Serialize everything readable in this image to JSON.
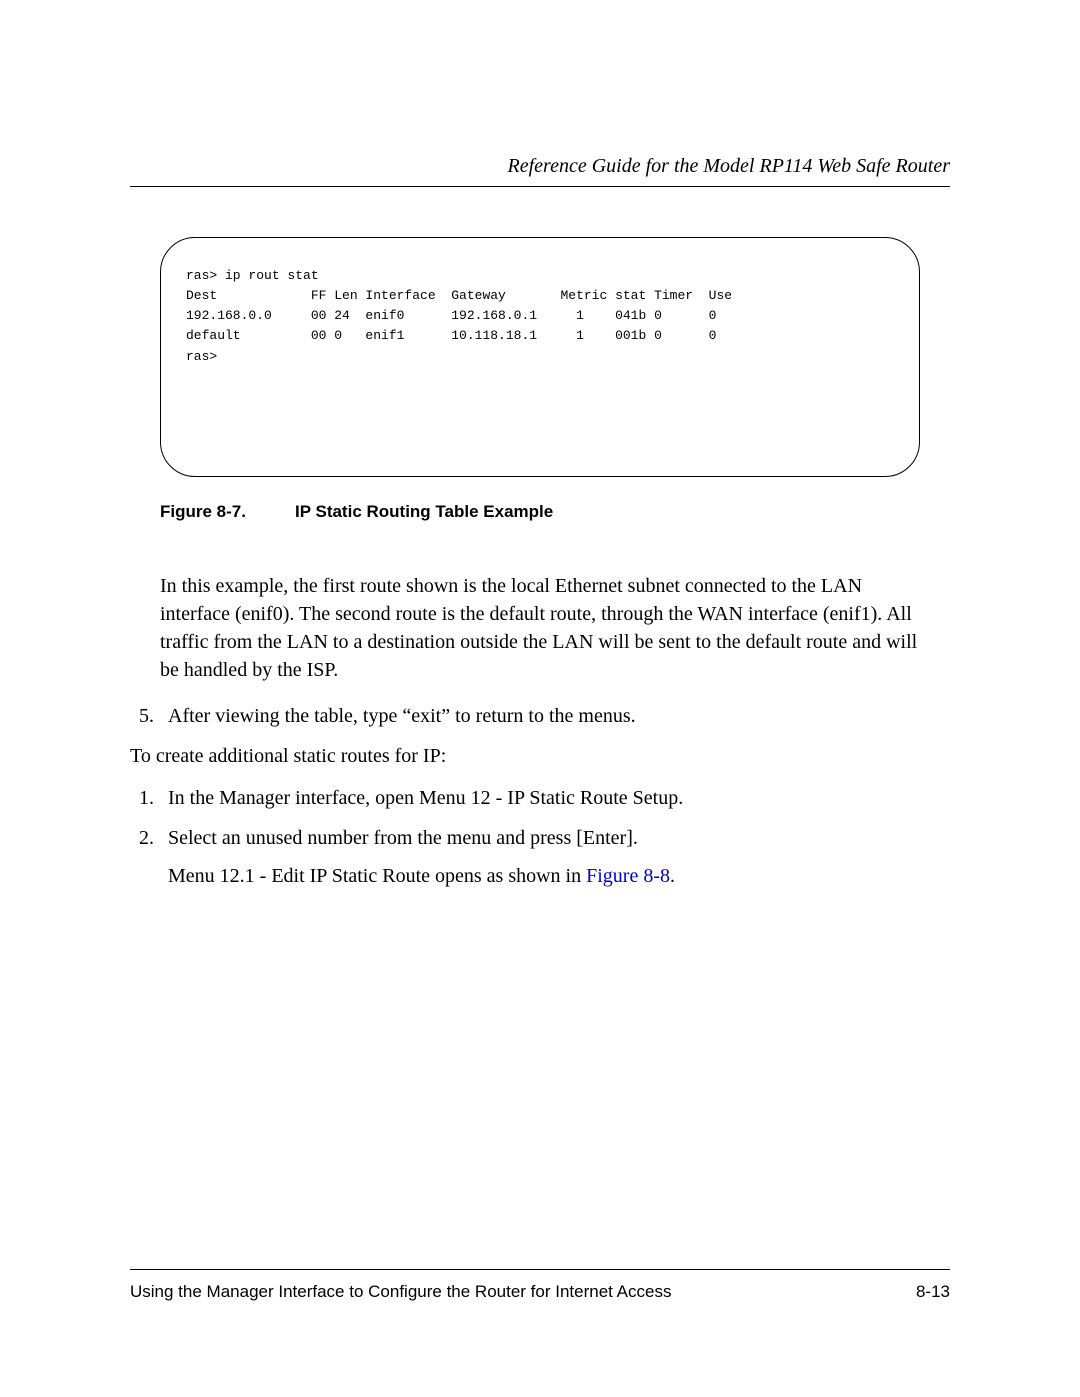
{
  "header": {
    "title": "Reference Guide for the Model RP114 Web Safe Router"
  },
  "terminal": {
    "content": "ras> ip rout stat\nDest            FF Len Interface  Gateway       Metric stat Timer  Use\n192.168.0.0     00 24  enif0      192.168.0.1     1    041b 0      0\ndefault         00 0   enif1      10.118.18.1     1    001b 0      0\nras>"
  },
  "figure": {
    "label": "Figure 8-7.",
    "title": "IP Static Routing Table Example"
  },
  "paragraphs": {
    "example": "In this example, the first route shown is the local Ethernet subnet connected to the LAN interface (enif0). The second route is the default route, through the WAN interface (enif1). All traffic from the LAN to a destination outside the LAN will be sent to the default route and will be handled by the ISP.",
    "intro": "To create additional static routes for IP:"
  },
  "steps_a": {
    "5": {
      "marker": "5.",
      "text": "After viewing the table, type “exit” to return to the menus."
    }
  },
  "steps_b": {
    "1": {
      "marker": "1.",
      "text": "In the Manager interface, open Menu 12 - IP Static Route Setup."
    },
    "2": {
      "marker": "2.",
      "text": "Select an unused number from the menu and press [Enter].",
      "sub_prefix": "Menu 12.1 - Edit IP Static Route opens as shown in ",
      "sub_link": "Figure 8-8",
      "sub_suffix": "."
    }
  },
  "footer": {
    "left": "Using the Manager Interface to Configure the Router for Internet Access",
    "right": "8-13"
  }
}
